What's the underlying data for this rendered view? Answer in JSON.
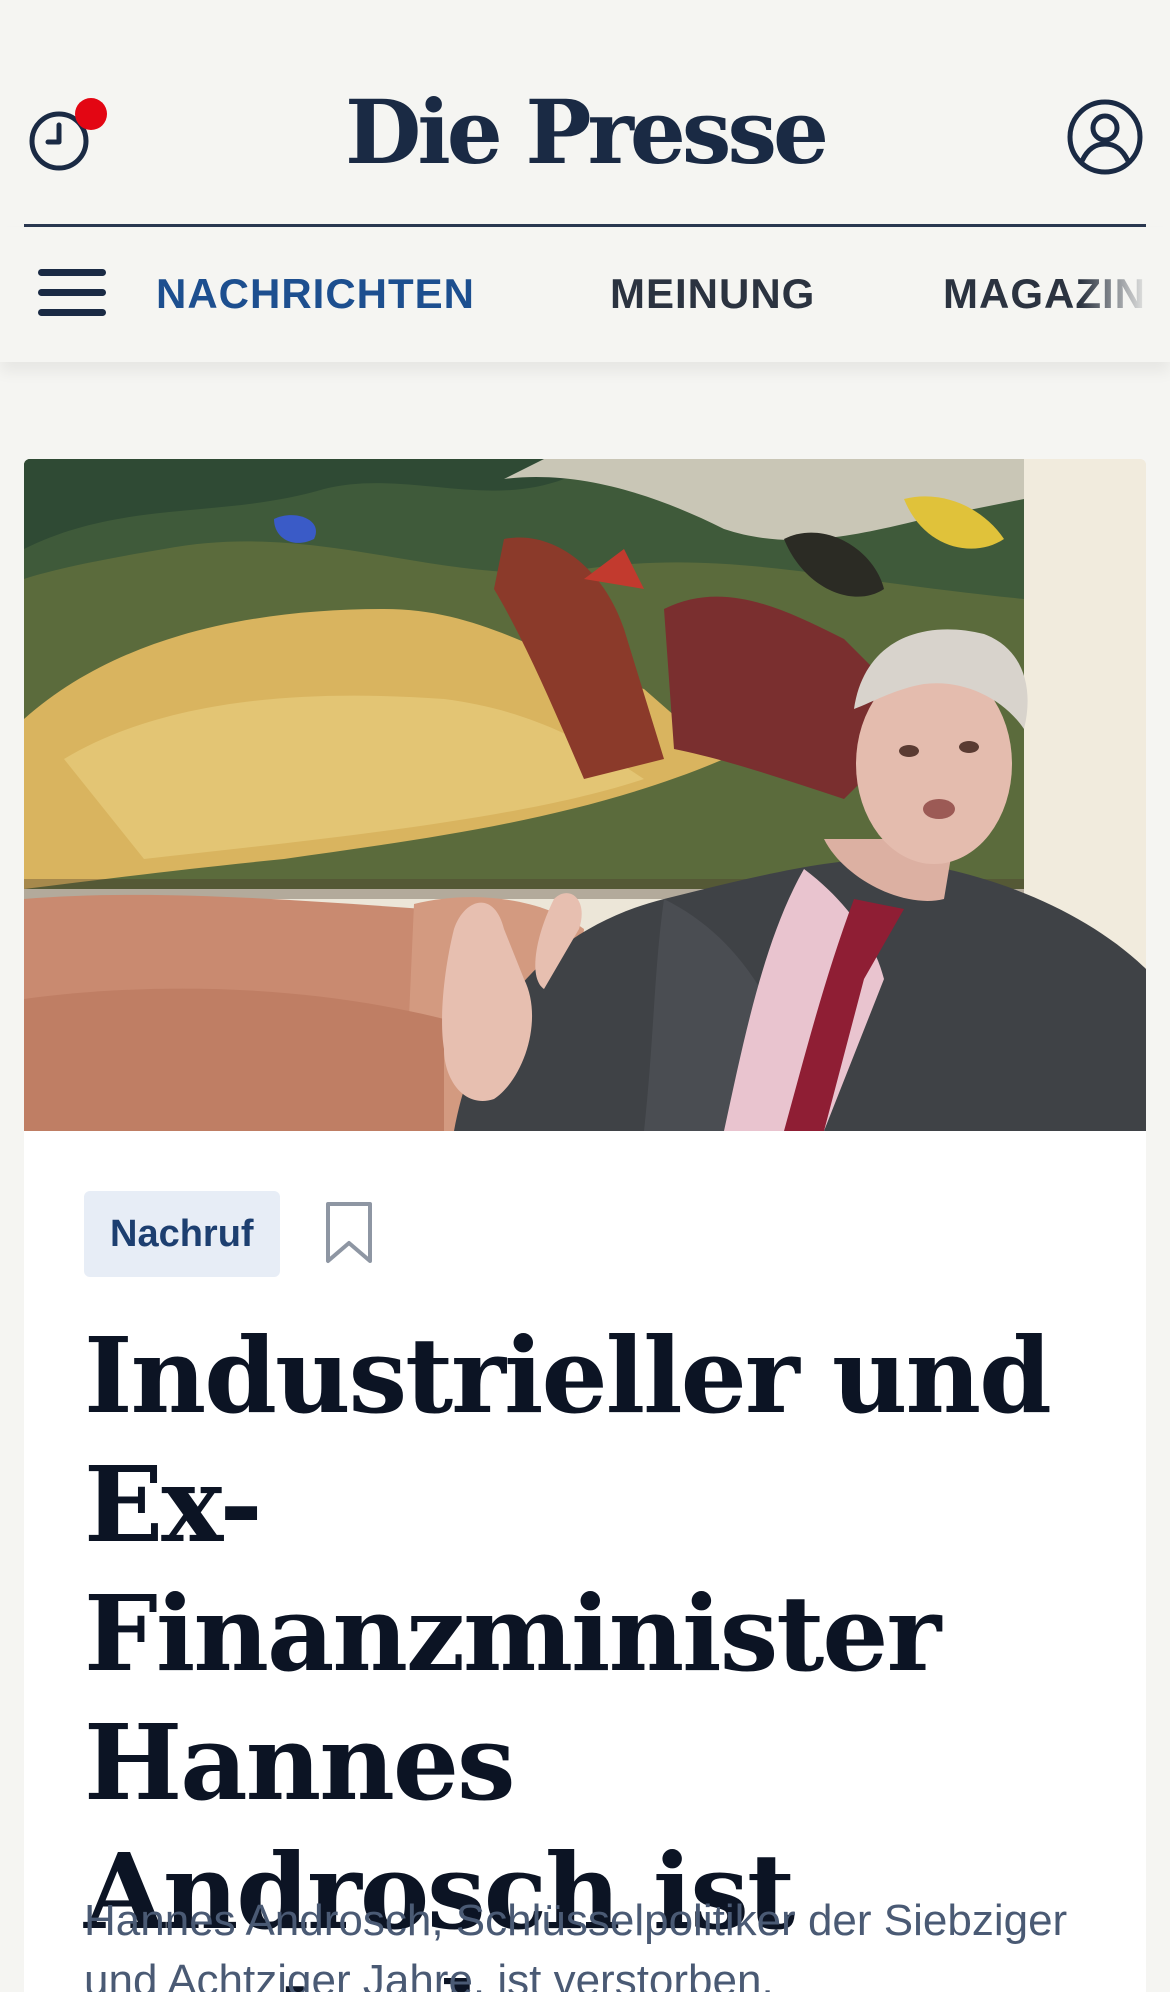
{
  "header": {
    "logo": "Die Presse",
    "history_icon": "clock-history-icon",
    "account_icon": "user-account-icon",
    "menu_icon": "hamburger-menu-icon"
  },
  "nav": {
    "items": [
      {
        "label": "NACHRICHTEN",
        "active": true
      },
      {
        "label": "MEINUNG",
        "active": false
      },
      {
        "label": "MAGAZIN",
        "active": false
      }
    ]
  },
  "article": {
    "category": "Nachruf",
    "bookmark_icon": "bookmark-icon",
    "headline": "Industrieller und Ex-Finanzminister Hannes Androsch ist gestorben",
    "lead": "Hannes Androsch, Schlüsselpolitiker der Siebziger und Achtziger Jahre, ist verstorben."
  },
  "colors": {
    "brand_navy": "#1a2a44",
    "nav_active": "#1d4f8f",
    "notification_red": "#e30613",
    "tag_background": "#e7edf6"
  }
}
